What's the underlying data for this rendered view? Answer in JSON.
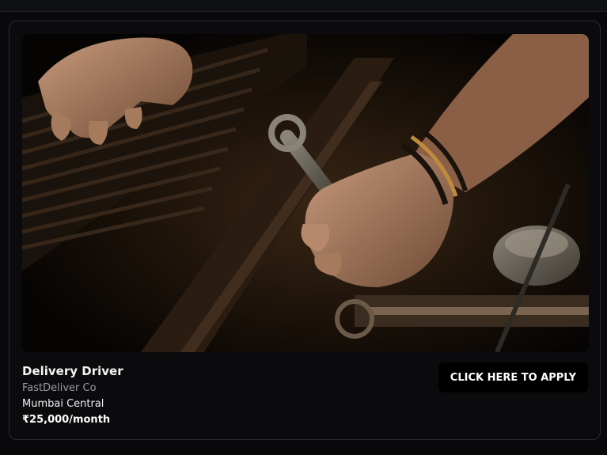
{
  "job": {
    "title": "Delivery Driver",
    "company": "FastDeliver Co",
    "location": "Mumbai Central",
    "salary": "₹25,000/month",
    "apply_label": "CLICK HERE TO APPLY"
  },
  "colors": {
    "page_bg": "#09090b",
    "card_bg": "#0b0b0d",
    "button_bg": "#000000",
    "muted_text": "#9a9aa1"
  }
}
